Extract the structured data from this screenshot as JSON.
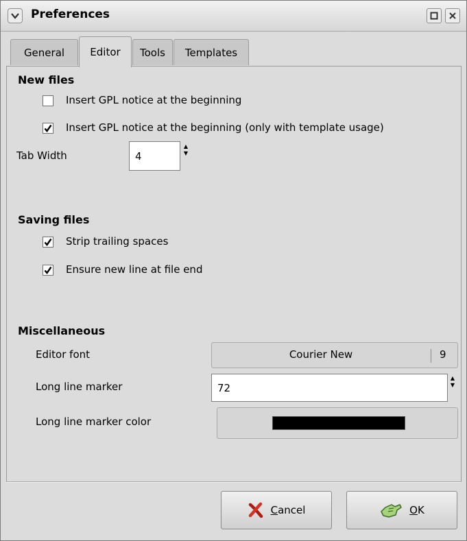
{
  "window": {
    "title": "Preferences"
  },
  "tabs": [
    {
      "label": "General"
    },
    {
      "label": "Editor",
      "active": true
    },
    {
      "label": "Tools"
    },
    {
      "label": "Templates"
    }
  ],
  "new_files": {
    "title": "New files",
    "gpl_notice": {
      "label": "Insert GPL notice at the beginning",
      "checked": false
    },
    "gpl_notice_template": {
      "label": "Insert GPL notice at the beginning (only with template usage)",
      "checked": true
    },
    "tab_width": {
      "label": "Tab Width",
      "value": "4"
    }
  },
  "saving_files": {
    "title": "Saving files",
    "strip_spaces": {
      "label": "Strip trailing spaces",
      "checked": true
    },
    "new_line_end": {
      "label": "Ensure new line at file end",
      "checked": true
    }
  },
  "misc": {
    "title": "Miscellaneous",
    "editor_font": {
      "label": "Editor font",
      "font": "Courier New",
      "size": "9"
    },
    "long_line_marker": {
      "label": "Long line marker",
      "value": "72"
    },
    "marker_color": {
      "label": "Long line marker color",
      "color": "#000000"
    }
  },
  "buttons": {
    "cancel": {
      "mnemonic": "C",
      "rest": "ancel"
    },
    "ok": {
      "mnemonic": "O",
      "rest": "K"
    }
  }
}
